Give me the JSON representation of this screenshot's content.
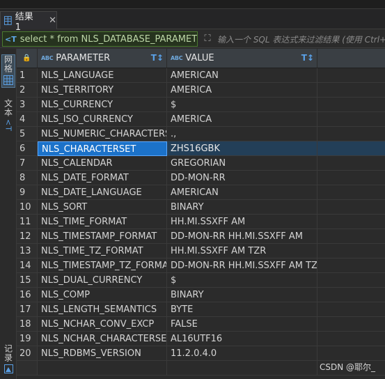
{
  "tab": {
    "label": "结果 1",
    "close": "✕",
    "icon": "grid-icon"
  },
  "filter": {
    "sql": "select * from NLS_DATABASE_PARAMETERS",
    "placeholder": "输入一个 SQL 表达式来过滤结果 (使用 Ctrl+"
  },
  "sidebar": {
    "grid_label": "网格",
    "text_label": "文本",
    "record_label": "记录"
  },
  "grid": {
    "columns": [
      {
        "type_badge": "ABC",
        "label": "PARAMETER"
      },
      {
        "type_badge": "ABC",
        "label": "VALUE"
      }
    ],
    "selected_row": 6,
    "rows": [
      {
        "n": "1",
        "parameter": "NLS_LANGUAGE",
        "value": "AMERICAN"
      },
      {
        "n": "2",
        "parameter": "NLS_TERRITORY",
        "value": "AMERICA"
      },
      {
        "n": "3",
        "parameter": "NLS_CURRENCY",
        "value": "$"
      },
      {
        "n": "4",
        "parameter": "NLS_ISO_CURRENCY",
        "value": "AMERICA"
      },
      {
        "n": "5",
        "parameter": "NLS_NUMERIC_CHARACTERS",
        "value": ".,"
      },
      {
        "n": "6",
        "parameter": "NLS_CHARACTERSET",
        "value": "ZHS16GBK"
      },
      {
        "n": "7",
        "parameter": "NLS_CALENDAR",
        "value": "GREGORIAN"
      },
      {
        "n": "8",
        "parameter": "NLS_DATE_FORMAT",
        "value": "DD-MON-RR"
      },
      {
        "n": "9",
        "parameter": "NLS_DATE_LANGUAGE",
        "value": "AMERICAN"
      },
      {
        "n": "10",
        "parameter": "NLS_SORT",
        "value": "BINARY"
      },
      {
        "n": "11",
        "parameter": "NLS_TIME_FORMAT",
        "value": "HH.MI.SSXFF AM"
      },
      {
        "n": "12",
        "parameter": "NLS_TIMESTAMP_FORMAT",
        "value": "DD-MON-RR HH.MI.SSXFF AM"
      },
      {
        "n": "13",
        "parameter": "NLS_TIME_TZ_FORMAT",
        "value": "HH.MI.SSXFF AM TZR"
      },
      {
        "n": "14",
        "parameter": "NLS_TIMESTAMP_TZ_FORMAT",
        "value": "DD-MON-RR HH.MI.SSXFF AM TZR"
      },
      {
        "n": "15",
        "parameter": "NLS_DUAL_CURRENCY",
        "value": "$"
      },
      {
        "n": "16",
        "parameter": "NLS_COMP",
        "value": "BINARY"
      },
      {
        "n": "17",
        "parameter": "NLS_LENGTH_SEMANTICS",
        "value": "BYTE"
      },
      {
        "n": "18",
        "parameter": "NLS_NCHAR_CONV_EXCP",
        "value": "FALSE"
      },
      {
        "n": "19",
        "parameter": "NLS_NCHAR_CHARACTERSET",
        "value": "AL16UTF16"
      },
      {
        "n": "20",
        "parameter": "NLS_RDBMS_VERSION",
        "value": "11.2.0.4.0"
      }
    ]
  },
  "watermark": "CSDN @耶尔_",
  "colors": {
    "selection": "#1c72c9",
    "sql_text": "#bcd6a6",
    "accent": "#5aa0e6"
  }
}
